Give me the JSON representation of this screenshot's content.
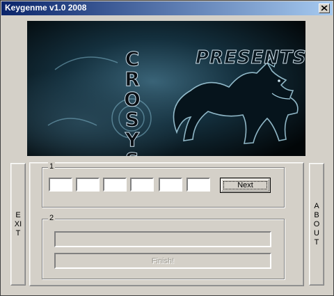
{
  "window": {
    "title": "Keygenme v1.0 2008",
    "close_glyph": "X"
  },
  "banner": {
    "vertical_text": [
      "C",
      "R",
      "O",
      "S",
      "Y",
      "S"
    ],
    "presents_text": "PRESENTS"
  },
  "exit_button": {
    "label": "EXIT"
  },
  "about_button": {
    "label": "ABOUT"
  },
  "step1": {
    "group_label": "1",
    "key_fields": [
      "",
      "",
      "",
      "",
      "",
      ""
    ],
    "next_label": "Next"
  },
  "step2": {
    "group_label": "2",
    "serial_value": "",
    "finish_label": "Finish!"
  }
}
